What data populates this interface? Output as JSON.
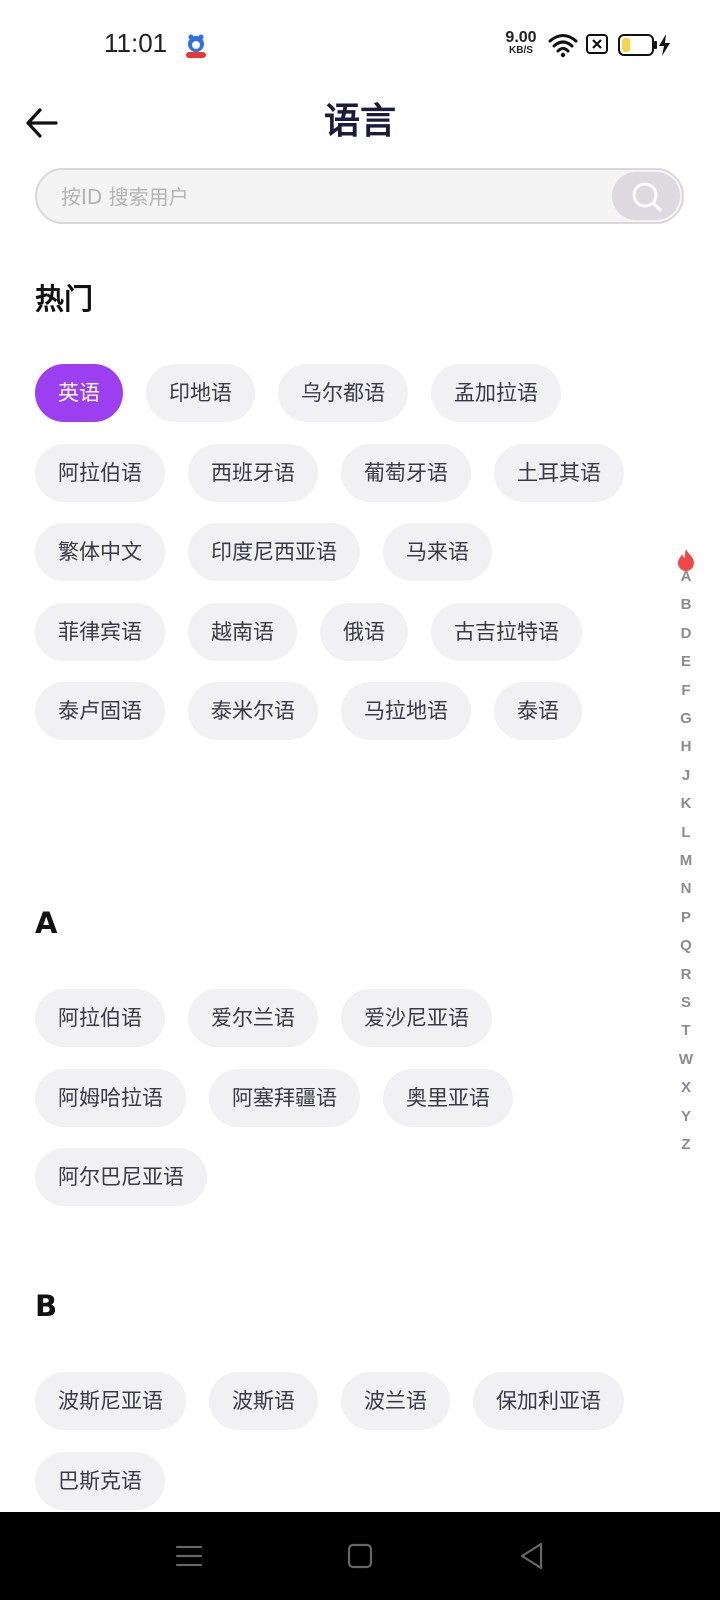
{
  "status_bar": {
    "time": "11:01",
    "net_speed_value": "9.00",
    "net_speed_unit": "KB/S",
    "icons": [
      "baidu-app-icon",
      "wifi-icon",
      "sim-blocked-icon",
      "battery-charging-icon"
    ],
    "battery_level_fraction": 0.3
  },
  "header": {
    "title": "语言"
  },
  "search": {
    "placeholder": "按ID 搜索用户",
    "value": ""
  },
  "sections": {
    "hot": {
      "title": "热门",
      "chips": [
        "英语",
        "印地语",
        "乌尔都语",
        "孟加拉语",
        "阿拉伯语",
        "西班牙语",
        "葡萄牙语",
        "土耳其语",
        "繁体中文",
        "印度尼西亚语",
        "马来语",
        "菲律宾语",
        "越南语",
        "俄语",
        "古吉拉特语",
        "泰卢固语",
        "泰米尔语",
        "马拉地语",
        "泰语"
      ],
      "selected": "英语"
    },
    "a": {
      "title": "A",
      "chips": [
        "阿拉伯语",
        "爱尔兰语",
        "爱沙尼亚语",
        "阿姆哈拉语",
        "阿塞拜疆语",
        "奥里亚语",
        "阿尔巴尼亚语"
      ]
    },
    "b": {
      "title": "B",
      "chips": [
        "波斯尼亚语",
        "波斯语",
        "波兰语",
        "保加利亚语",
        "巴斯克语"
      ]
    }
  },
  "alpha_index": [
    "A",
    "B",
    "D",
    "E",
    "F",
    "G",
    "H",
    "J",
    "K",
    "L",
    "M",
    "N",
    "P",
    "Q",
    "R",
    "S",
    "T",
    "W",
    "X",
    "Y",
    "Z"
  ],
  "colors": {
    "accent": "#9b3ff0",
    "chip_bg": "#f1f1f3",
    "hot_icon": "#f04848"
  }
}
